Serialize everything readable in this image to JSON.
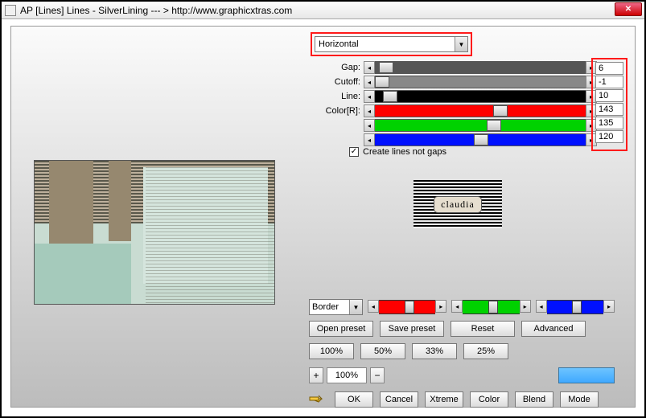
{
  "window": {
    "title": "AP [Lines]  Lines - SilverLining   --- > http://www.graphicxtras.com"
  },
  "direction": {
    "selected": "Horizontal"
  },
  "params": {
    "labels": {
      "gap": "Gap:",
      "cutoff": "Cutoff:",
      "line": "Line:",
      "colorR": "Color[R]:"
    },
    "values": {
      "gap": "6",
      "cutoff": "-1",
      "line": "10",
      "r": "143",
      "g": "135",
      "b": "120"
    }
  },
  "checkbox": {
    "label": "Create lines not gaps",
    "checked": true
  },
  "logo": {
    "text": "claudia"
  },
  "borderSelect": {
    "selected": "Border"
  },
  "presetButtons": {
    "open": "Open preset",
    "save": "Save preset",
    "reset": "Reset",
    "advanced": "Advanced"
  },
  "zoomPresets": {
    "p100": "100%",
    "p50": "50%",
    "p33": "33%",
    "p25": "25%"
  },
  "zoom": {
    "plus": "+",
    "value": "100%",
    "minus": "−"
  },
  "actions": {
    "ok": "OK",
    "cancel": "Cancel",
    "xtreme": "Xtreme",
    "color": "Color",
    "blend": "Blend",
    "mode": "Mode"
  },
  "colors": {
    "red": "#ff0000",
    "green": "#00d200",
    "blue": "#0010ff"
  }
}
